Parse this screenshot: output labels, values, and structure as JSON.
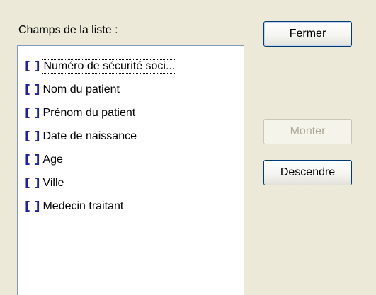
{
  "list": {
    "label": "Champs de la liste :",
    "items": [
      {
        "marker": "[ ]",
        "label": "Numéro de sécurité soci..."
      },
      {
        "marker": "[ ]",
        "label": "Nom du patient"
      },
      {
        "marker": "[ ]",
        "label": "Prénom du patient"
      },
      {
        "marker": "[ ]",
        "label": "Date de naissance"
      },
      {
        "marker": "[ ]",
        "label": "Age"
      },
      {
        "marker": "[ ]",
        "label": "Ville"
      },
      {
        "marker": "[ ]",
        "label": "Medecin traitant"
      }
    ]
  },
  "buttons": {
    "close_label": "Fermer",
    "up_label": "Monter",
    "down_label": "Descendre"
  },
  "colors": {
    "background": "#ece9d8",
    "marker": "#1f1fa8",
    "disabled_text": "#aca899"
  }
}
